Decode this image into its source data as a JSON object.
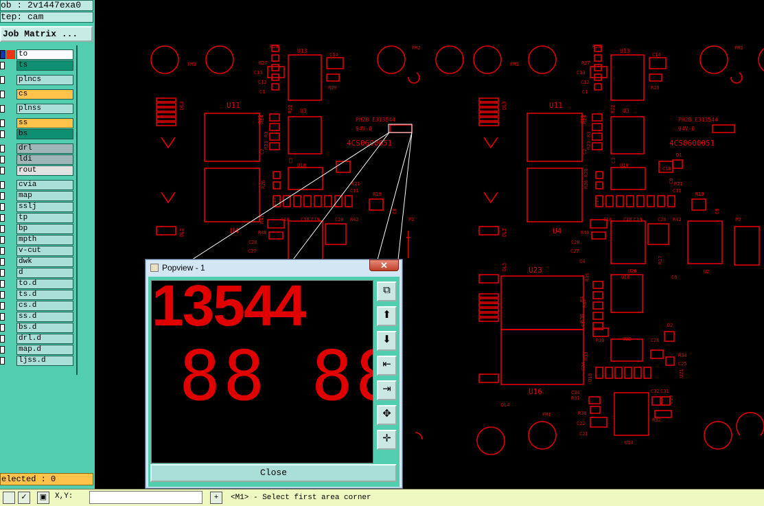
{
  "header": {
    "job_field": "ob : 2v1447exa0",
    "step_field": "tep: cam",
    "job_matrix_button": "Job Matrix ..."
  },
  "layers": [
    {
      "name": "to",
      "color": "#ffffff"
    },
    {
      "name": "ts",
      "color": "#0f8f72"
    },
    {
      "name": "plncs",
      "color": "#a9ded9"
    },
    {
      "name": "cs",
      "color": "#ffc24a"
    },
    {
      "name": "plnss",
      "color": "#a9ded9"
    },
    {
      "name": "ss",
      "color": "#ffc24a"
    },
    {
      "name": "bs",
      "color": "#0f8f72"
    },
    {
      "name": "drl",
      "color": "#9fb6b9"
    },
    {
      "name": "ldi",
      "color": "#9fb6b9"
    },
    {
      "name": "rout",
      "color": "#e2e2e2"
    },
    {
      "name": "cvia",
      "color": "#a9ded9"
    },
    {
      "name": "map",
      "color": "#a9ded9"
    },
    {
      "name": "sslj",
      "color": "#a9ded9"
    },
    {
      "name": "tp",
      "color": "#a9ded9"
    },
    {
      "name": "bp",
      "color": "#a9ded9"
    },
    {
      "name": "mpth",
      "color": "#a9ded9"
    },
    {
      "name": "v-cut",
      "color": "#a9ded9"
    },
    {
      "name": "dwk",
      "color": "#a9ded9"
    },
    {
      "name": "d",
      "color": "#a9ded9"
    },
    {
      "name": "to.d",
      "color": "#a9ded9"
    },
    {
      "name": "ts.d",
      "color": "#a9ded9"
    },
    {
      "name": "cs.d",
      "color": "#a9ded9"
    },
    {
      "name": "ss.d",
      "color": "#a9ded9"
    },
    {
      "name": "bs.d",
      "color": "#a9ded9"
    },
    {
      "name": "drl.d",
      "color": "#a9ded9"
    },
    {
      "name": "map.d",
      "color": "#a9ded9"
    },
    {
      "name": "ljss.d",
      "color": "#a9ded9"
    }
  ],
  "selected_label": "elected : 0",
  "status": {
    "coords_label": "X,Y:",
    "message": "<M1> - Select first area corner"
  },
  "popview": {
    "title": "Popview - 1",
    "close_x": "✕",
    "big_text": "13544",
    "digits_text": "88 88",
    "close_button": "Close",
    "tools": [
      "zoom-fit-icon",
      "pan-up-icon",
      "pan-down-icon",
      "pan-left-icon",
      "pan-right-icon",
      "zoom-in-icon",
      "zoom-out-icon"
    ]
  },
  "board": {
    "left": {
      "u11": "U11",
      "u4": "U4",
      "u13": "U13",
      "u3": "U3",
      "u10": "U10",
      "fm3": "FM3",
      "fm2": "FM2",
      "dl3": "DL3",
      "dl2": "DL2",
      "pcb_text1": "PH2B E313544",
      "pcb_text2": "94V-0",
      "pcb_text3": "4CS0600051",
      "r28": "R28",
      "r27": "R27",
      "c13": "C13",
      "c12": "C12",
      "c1": "C1",
      "c14": "C14",
      "r29": "R29",
      "r22": "R22",
      "r24": "R24",
      "r3": "R3",
      "r23": "R23",
      "c2": "C2",
      "c3": "C3",
      "r25": "R25",
      "c16": "C16",
      "c17": "C17",
      "c18": "C18",
      "c19": "C19",
      "c20": "C20",
      "r42": "R42",
      "r21": "R21",
      "c11": "C11",
      "r19": "R19",
      "r41": "R41",
      "r40": "R40",
      "c28": "C28",
      "c27": "C27",
      "r26": "R26",
      "c8": "C8",
      "p2": "P2"
    },
    "right": {
      "u11": "U11",
      "u4": "U4",
      "u13": "U13",
      "u3": "U3",
      "u10": "U10",
      "u23": "U23",
      "u16": "U16",
      "u2": "U2",
      "u26": "U26",
      "u22": "U22",
      "u14": "U14",
      "u18": "U18",
      "fm3": "FM3",
      "fm2": "FM2",
      "fm1": "FM1",
      "dl3": "DL3",
      "dl2": "DL2",
      "dl4": "DL4",
      "dl5": "DL5",
      "pcb_text1": "PH2B E313544",
      "pcb_text2": "94V-0",
      "pcb_text3": "4CS0600051",
      "d1": "D1",
      "d2": "D2",
      "p2": "P2",
      "r28": "R28",
      "r27": "R27",
      "c13": "C13",
      "c12": "C12",
      "c1": "C1",
      "c14": "C14",
      "r29": "R29",
      "r22": "R22",
      "r24": "R24",
      "r3": "R3",
      "r23": "R23",
      "c2": "C2",
      "c3": "C3",
      "r25": "R25",
      "c16": "C16",
      "c17": "C17",
      "c18": "C18",
      "c19": "C19",
      "c20": "C20",
      "r42": "R42",
      "r21": "R21",
      "c11": "C11",
      "r19": "R19",
      "r40": "R40",
      "c28": "C28",
      "c27": "C27",
      "c4": "C4",
      "r17": "R17",
      "c6": "C6",
      "r35": "R35",
      "r4": "R4",
      "r37": "R37",
      "r36": "R36",
      "c5": "C5",
      "r39": "R39",
      "r33": "R33",
      "c24": "C24",
      "c26": "C26",
      "r34": "R34",
      "c25": "C25",
      "u21": "U21",
      "c34": "C34",
      "r31": "R31",
      "c32": "C32",
      "c31": "C31",
      "c29": "C29",
      "r30": "R30",
      "r32": "R32",
      "c22": "C22",
      "c21": "C21",
      "c10": "C10",
      "c9": "C9",
      "c8": "C8",
      "r20": "R20",
      "r26": "R26"
    }
  }
}
